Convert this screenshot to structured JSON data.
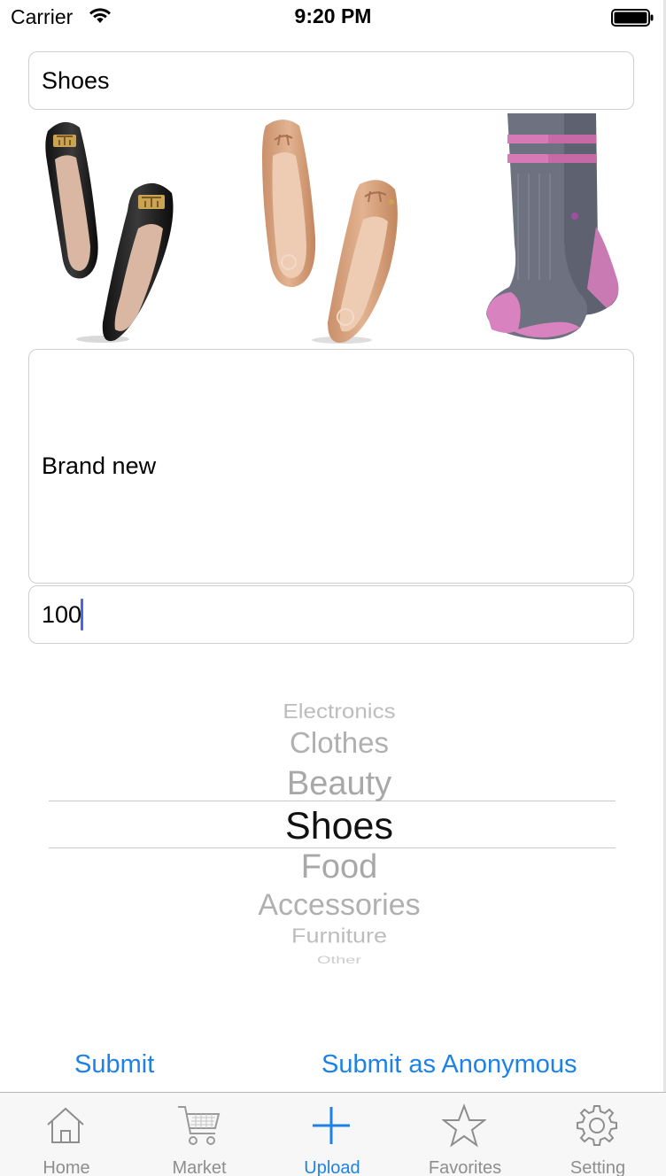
{
  "status_bar": {
    "carrier": "Carrier",
    "time": "9:20 PM",
    "wifi_icon": "wifi-icon",
    "battery_icon": "battery-icon"
  },
  "form": {
    "title_value": "Shoes",
    "description_value": "Brand new",
    "price_value": "100"
  },
  "photos": [
    {
      "icon": "black-flats-photo"
    },
    {
      "icon": "nude-flats-photo"
    },
    {
      "icon": "socks-photo"
    }
  ],
  "picker": {
    "options": [
      "Electronics",
      "Clothes",
      "Beauty",
      "Shoes",
      "Food",
      "Accessories",
      "Furniture",
      "Other"
    ],
    "selected": "Shoes"
  },
  "actions": {
    "submit_label": "Submit",
    "submit_anonymous_label": "Submit as Anonymous"
  },
  "tab_bar": {
    "active": "Upload",
    "tabs": [
      {
        "label": "Home",
        "icon": "home-icon"
      },
      {
        "label": "Market",
        "icon": "cart-icon"
      },
      {
        "label": "Upload",
        "icon": "plus-icon"
      },
      {
        "label": "Favorites",
        "icon": "star-icon"
      },
      {
        "label": "Setting",
        "icon": "gear-icon"
      }
    ]
  },
  "colors": {
    "accent": "#1d82e8",
    "caret": "#4a67e0",
    "inactive_tab": "#8e8e8e",
    "picker_selected": "#111111",
    "picker_faded": "#b3b3b3"
  }
}
